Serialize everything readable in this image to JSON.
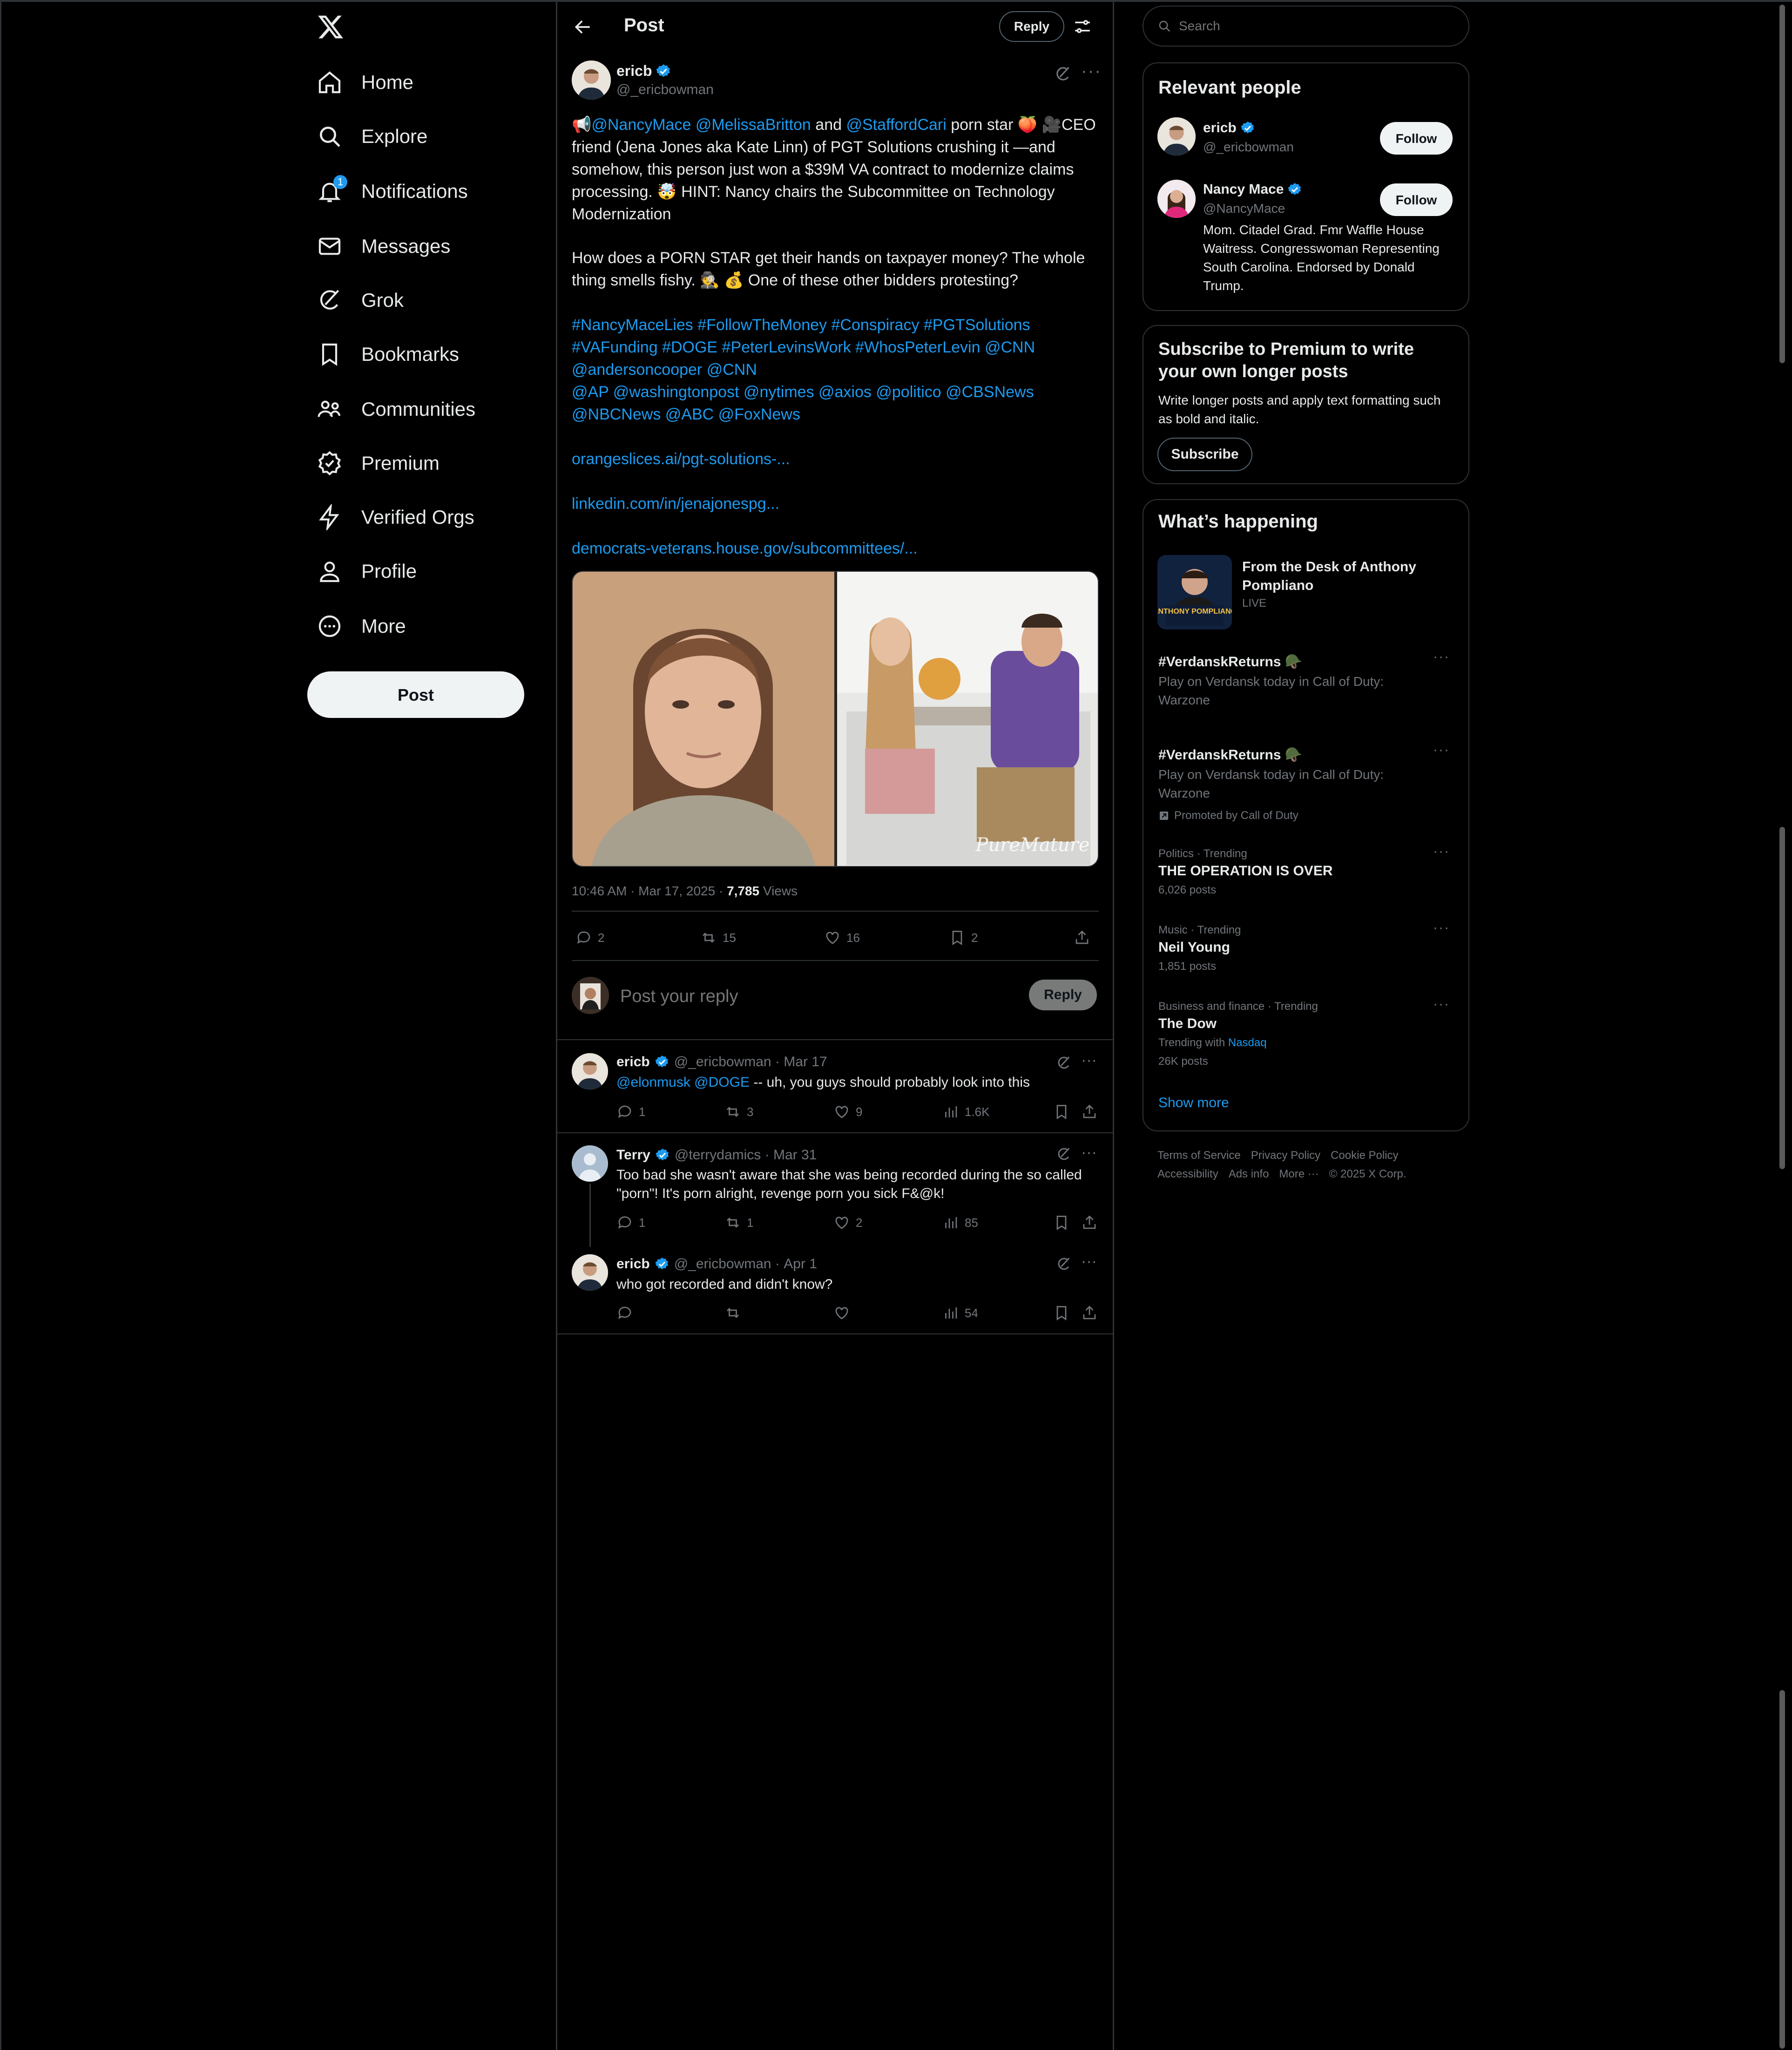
{
  "nav": {
    "logo": "X",
    "items": [
      {
        "label": "Home",
        "icon": "home-icon"
      },
      {
        "label": "Explore",
        "icon": "search-icon"
      },
      {
        "label": "Notifications",
        "icon": "bell-icon",
        "badge": "1"
      },
      {
        "label": "Messages",
        "icon": "mail-icon"
      },
      {
        "label": "Grok",
        "icon": "grok-icon"
      },
      {
        "label": "Bookmarks",
        "icon": "bookmark-icon"
      },
      {
        "label": "Communities",
        "icon": "communities-icon"
      },
      {
        "label": "Premium",
        "icon": "premium-icon"
      },
      {
        "label": "Verified Orgs",
        "icon": "lightning-icon"
      },
      {
        "label": "Profile",
        "icon": "profile-icon"
      },
      {
        "label": "More",
        "icon": "more-circle-icon"
      }
    ],
    "post_label": "Post"
  },
  "header": {
    "title": "Post",
    "reply_label": "Reply"
  },
  "post": {
    "author_name": "ericb",
    "author_handle": "@_ericbowman",
    "para1": [
      {
        "t": "📢",
        "c": ""
      },
      {
        "t": "@NancyMace @MelissaBritton",
        "c": "blue"
      },
      {
        "t": " and ",
        "c": ""
      },
      {
        "t": "@StaffordCari",
        "c": "blue"
      },
      {
        "t": "  porn star 🍑 🎥CEO friend (Jena Jones aka Kate Linn) of PGT Solutions crushing it —and somehow, this person just won a $39M VA contract to modernize claims processing. 🤯 HINT: Nancy chairs the Subcommittee on Technology Modernization",
        "c": ""
      }
    ],
    "para2": "How does a PORN STAR get their hands on taxpayer money? The whole thing smells fishy. 🕵️ 💰 One of these other bidders protesting?",
    "tags_line1": "#NancyMaceLies #FollowTheMoney #Conspiracy #PGTSolutions",
    "tags_line2": "#VAFunding #DOGE #PeterLevinsWork #WhosPeterLevin @CNN",
    "tags_line3": "@andersoncooper @CNN",
    "tags_line4": "@AP @washingtonpost  @nytimes @axios @politico @CBSNews",
    "tags_line5": "@NBCNews @ABC @FoxNews",
    "link1": "orangeslices.ai/pgt-solutions-...",
    "link2": "linkedin.com/in/jenajonespg...",
    "link3": "democrats-veterans.house.gov/subcommittees/...",
    "image_watermark": "PureMature",
    "timestamp": "10:46 AM · Mar 17, 2025 · ",
    "views_count": "7,785",
    "views_label": " Views",
    "replies": "2",
    "reposts": "15",
    "likes": "16",
    "bookmarks": "2"
  },
  "composer": {
    "placeholder": "Post your reply",
    "reply_label": "Reply"
  },
  "replies": [
    {
      "name": "ericb",
      "handle": "@_ericbowman",
      "time": "Mar 17",
      "mentions": "@elonmusk @DOGE",
      "text": " -- uh, you guys should probably look into this",
      "replies": "1",
      "reposts": "3",
      "likes": "9",
      "views": "1.6K"
    },
    {
      "name": "Terry",
      "handle": "@terrydamics",
      "time": "Mar 31",
      "text": "Too bad she wasn't aware that she was being recorded during the so called \"porn\"! It's porn alright, revenge porn you sick F&@k!",
      "replies": "1",
      "reposts": "1",
      "likes": "2",
      "views": "85"
    },
    {
      "name": "ericb",
      "handle": "@_ericbowman",
      "time": "Apr 1",
      "text": "who got recorded and didn't know?",
      "views": "54"
    }
  ],
  "right": {
    "search_placeholder": "Search",
    "relevant_title": "Relevant people",
    "people": [
      {
        "name": "ericb",
        "handle": "@_ericbowman",
        "follow": "Follow"
      },
      {
        "name": "Nancy Mace",
        "handle": "@NancyMace",
        "follow": "Follow",
        "bio": "Mom. Citadel Grad. Fmr Waffle House Waitress. Congresswoman Representing South Carolina. Endorsed by Donald Trump."
      }
    ],
    "premium_title": "Subscribe to Premium to write your own longer posts",
    "premium_text": "Write longer posts and apply text formatting such as bold and italic.",
    "premium_button": "Subscribe",
    "happening_title": "What’s happening",
    "live_title": "From the Desk of Anthony Pompliano",
    "live_label": "LIVE",
    "live_thumb_text": "ANTHONY POMPLIANO",
    "trends": [
      {
        "name": "#VerdanskReturns 🪖",
        "desc": "Play on Verdansk today in Call of Duty: Warzone"
      },
      {
        "name": "#VerdanskReturns 🪖",
        "desc": "Play on Verdansk today in Call of Duty: Warzone",
        "promoted": "Promoted by Call of Duty"
      },
      {
        "context": "Politics · Trending",
        "name": "THE OPERATION IS OVER",
        "count": "6,026 posts"
      },
      {
        "context": "Music · Trending",
        "name": "Neil Young",
        "count": "1,851 posts"
      },
      {
        "context": "Business and finance · Trending",
        "name": "The Dow",
        "with_label": "Trending with ",
        "with_link": "Nasdaq",
        "count": "26K posts"
      }
    ],
    "show_more": "Show more",
    "footer_line1": [
      "Terms of Service",
      "Privacy Policy",
      "Cookie Policy"
    ],
    "footer_line2": [
      "Accessibility",
      "Ads info",
      "More ···",
      "© 2025 X Corp."
    ]
  },
  "colors": {
    "accent": "#1d9bf0",
    "background": "#000000",
    "border": "#2f3336",
    "muted": "#71767b",
    "text": "#e7e9ea"
  }
}
